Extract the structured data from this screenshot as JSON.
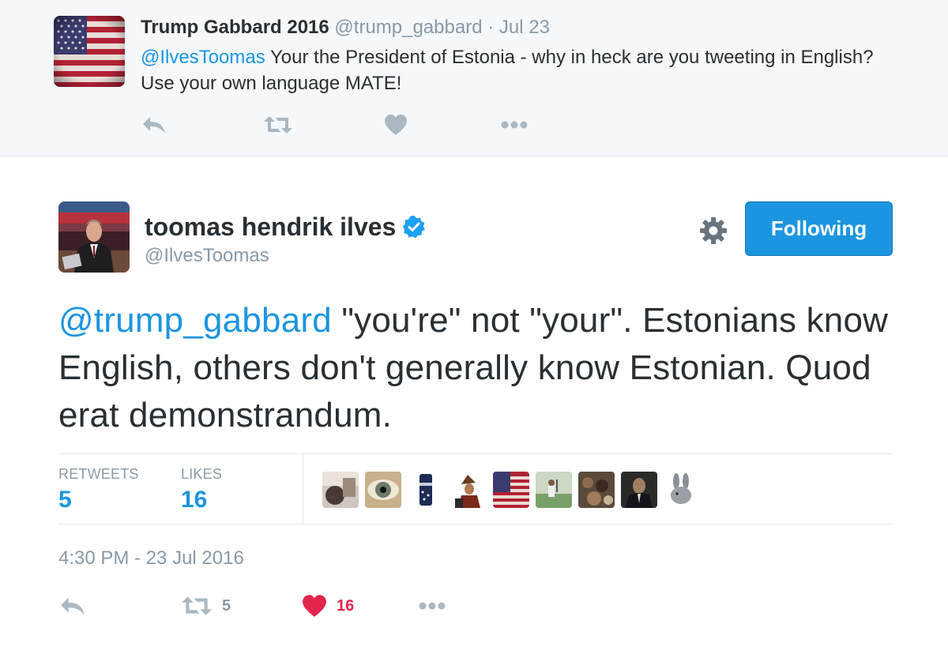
{
  "parent_tweet": {
    "name": "Trump Gabbard 2016",
    "handle": "@trump_gabbard",
    "separator": "·",
    "date": "Jul 23",
    "mention": "@IlvesToomas",
    "text": " Your the President of Estonia - why in heck are you tweeting in English? Use your own language MATE!",
    "avatar_icon": "us-flag-avatar",
    "actions": [
      "reply-icon",
      "retweet-icon",
      "like-icon",
      "more-icon"
    ]
  },
  "main_tweet": {
    "name": "toomas hendrik ilves",
    "verified_icon": "verified-badge-icon",
    "handle": "@IlvesToomas",
    "follow_label": "Following",
    "mention": "@trump_gabbard",
    "text": " \"you're\" not \"your\". Estonians know English, others don't generally know Estonian. Quod erat demonstrandum.",
    "stats": {
      "retweets_label": "RETWEETS",
      "retweets_value": "5",
      "likes_label": "LIKES",
      "likes_value": "16"
    },
    "likers": [
      "liker-1",
      "liker-eye",
      "liker-can",
      "liker-4",
      "liker-flag",
      "liker-6",
      "liker-7",
      "liker-8",
      "liker-rabbit"
    ],
    "timestamp": "4:30 PM - 23 Jul 2016",
    "actions": {
      "retweet_count": "5",
      "like_count": "16"
    }
  },
  "colors": {
    "link": "#1b95e0",
    "muted": "#8899a6",
    "text": "#292f33",
    "like": "#e2264d",
    "header_bg": "#f5f8fa"
  }
}
